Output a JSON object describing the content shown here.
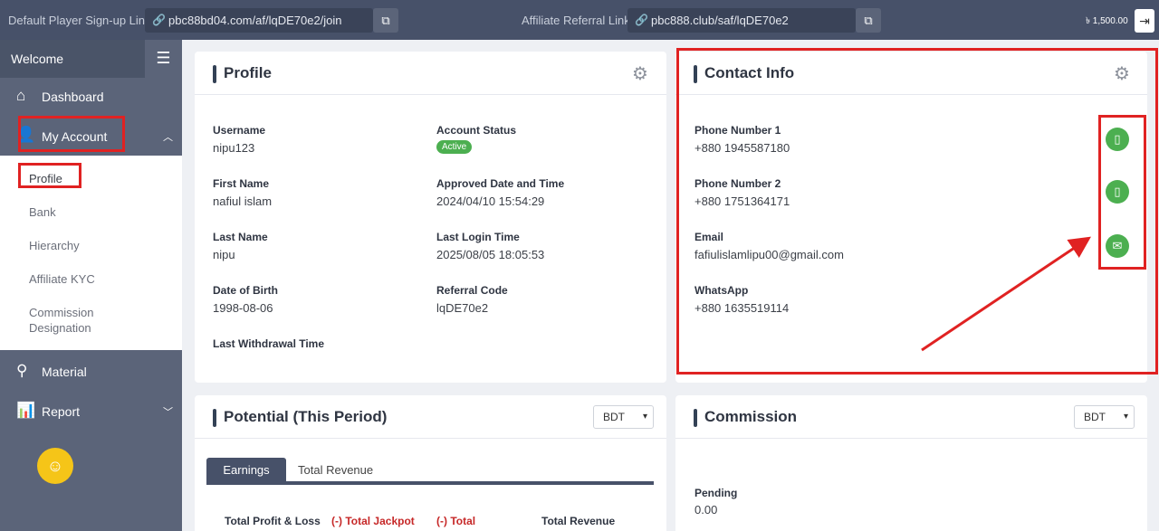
{
  "topbar": {
    "signup_label": "Default Player Sign-up Link",
    "signup_url": "pbc88bd04.com/af/lqDE70e2/join",
    "referral_label": "Affiliate Referral Link",
    "referral_url": "pbc888.club/saf/lqDE70e2",
    "balance": "৳ 1,500.00"
  },
  "sidebar": {
    "welcome": "Welcome",
    "dashboard": "Dashboard",
    "my_account": "My Account",
    "sub_items": [
      "Profile",
      "Bank",
      "Hierarchy",
      "Affiliate KYC",
      "Commission",
      "Designation"
    ],
    "material": "Material",
    "report": "Report"
  },
  "profile": {
    "title": "Profile",
    "username_label": "Username",
    "username": "nipu123",
    "status_label": "Account Status",
    "status": "Active",
    "first_name_label": "First Name",
    "first_name": "nafiul islam",
    "approved_label": "Approved Date and Time",
    "approved": "2024/04/10 15:54:29",
    "last_name_label": "Last Name",
    "last_name": "nipu",
    "last_login_label": "Last Login Time",
    "last_login": "2025/08/05 18:05:53",
    "dob_label": "Date of Birth",
    "dob": "1998-08-06",
    "referral_label": "Referral Code",
    "referral": "lqDE70e2",
    "withdrawal_label": "Last Withdrawal Time"
  },
  "contact": {
    "title": "Contact Info",
    "phone1_label": "Phone Number 1",
    "phone1": "+880 1945587180",
    "phone2_label": "Phone Number 2",
    "phone2": "+880 1751364171",
    "email_label": "Email",
    "email": "fafiulislamlipu00@gmail.com",
    "whatsapp_label": "WhatsApp",
    "whatsapp": "+880 1635519114"
  },
  "potential": {
    "title": "Potential (This Period)",
    "currency": "BDT",
    "tab_earnings": "Earnings",
    "tab_revenue": "Total Revenue",
    "col_pl": "Total Profit & Loss",
    "col_jackpot": "(-) Total Jackpot",
    "col_total": "(-) Total",
    "col_revenue": "Total Revenue"
  },
  "commission": {
    "title": "Commission",
    "currency": "BDT",
    "pending_label": "Pending",
    "pending": "0.00"
  },
  "colors": {
    "accent_red": "#e02222",
    "success_green": "#4caf50",
    "topbar": "#475169",
    "sidebar": "#5b6479"
  }
}
